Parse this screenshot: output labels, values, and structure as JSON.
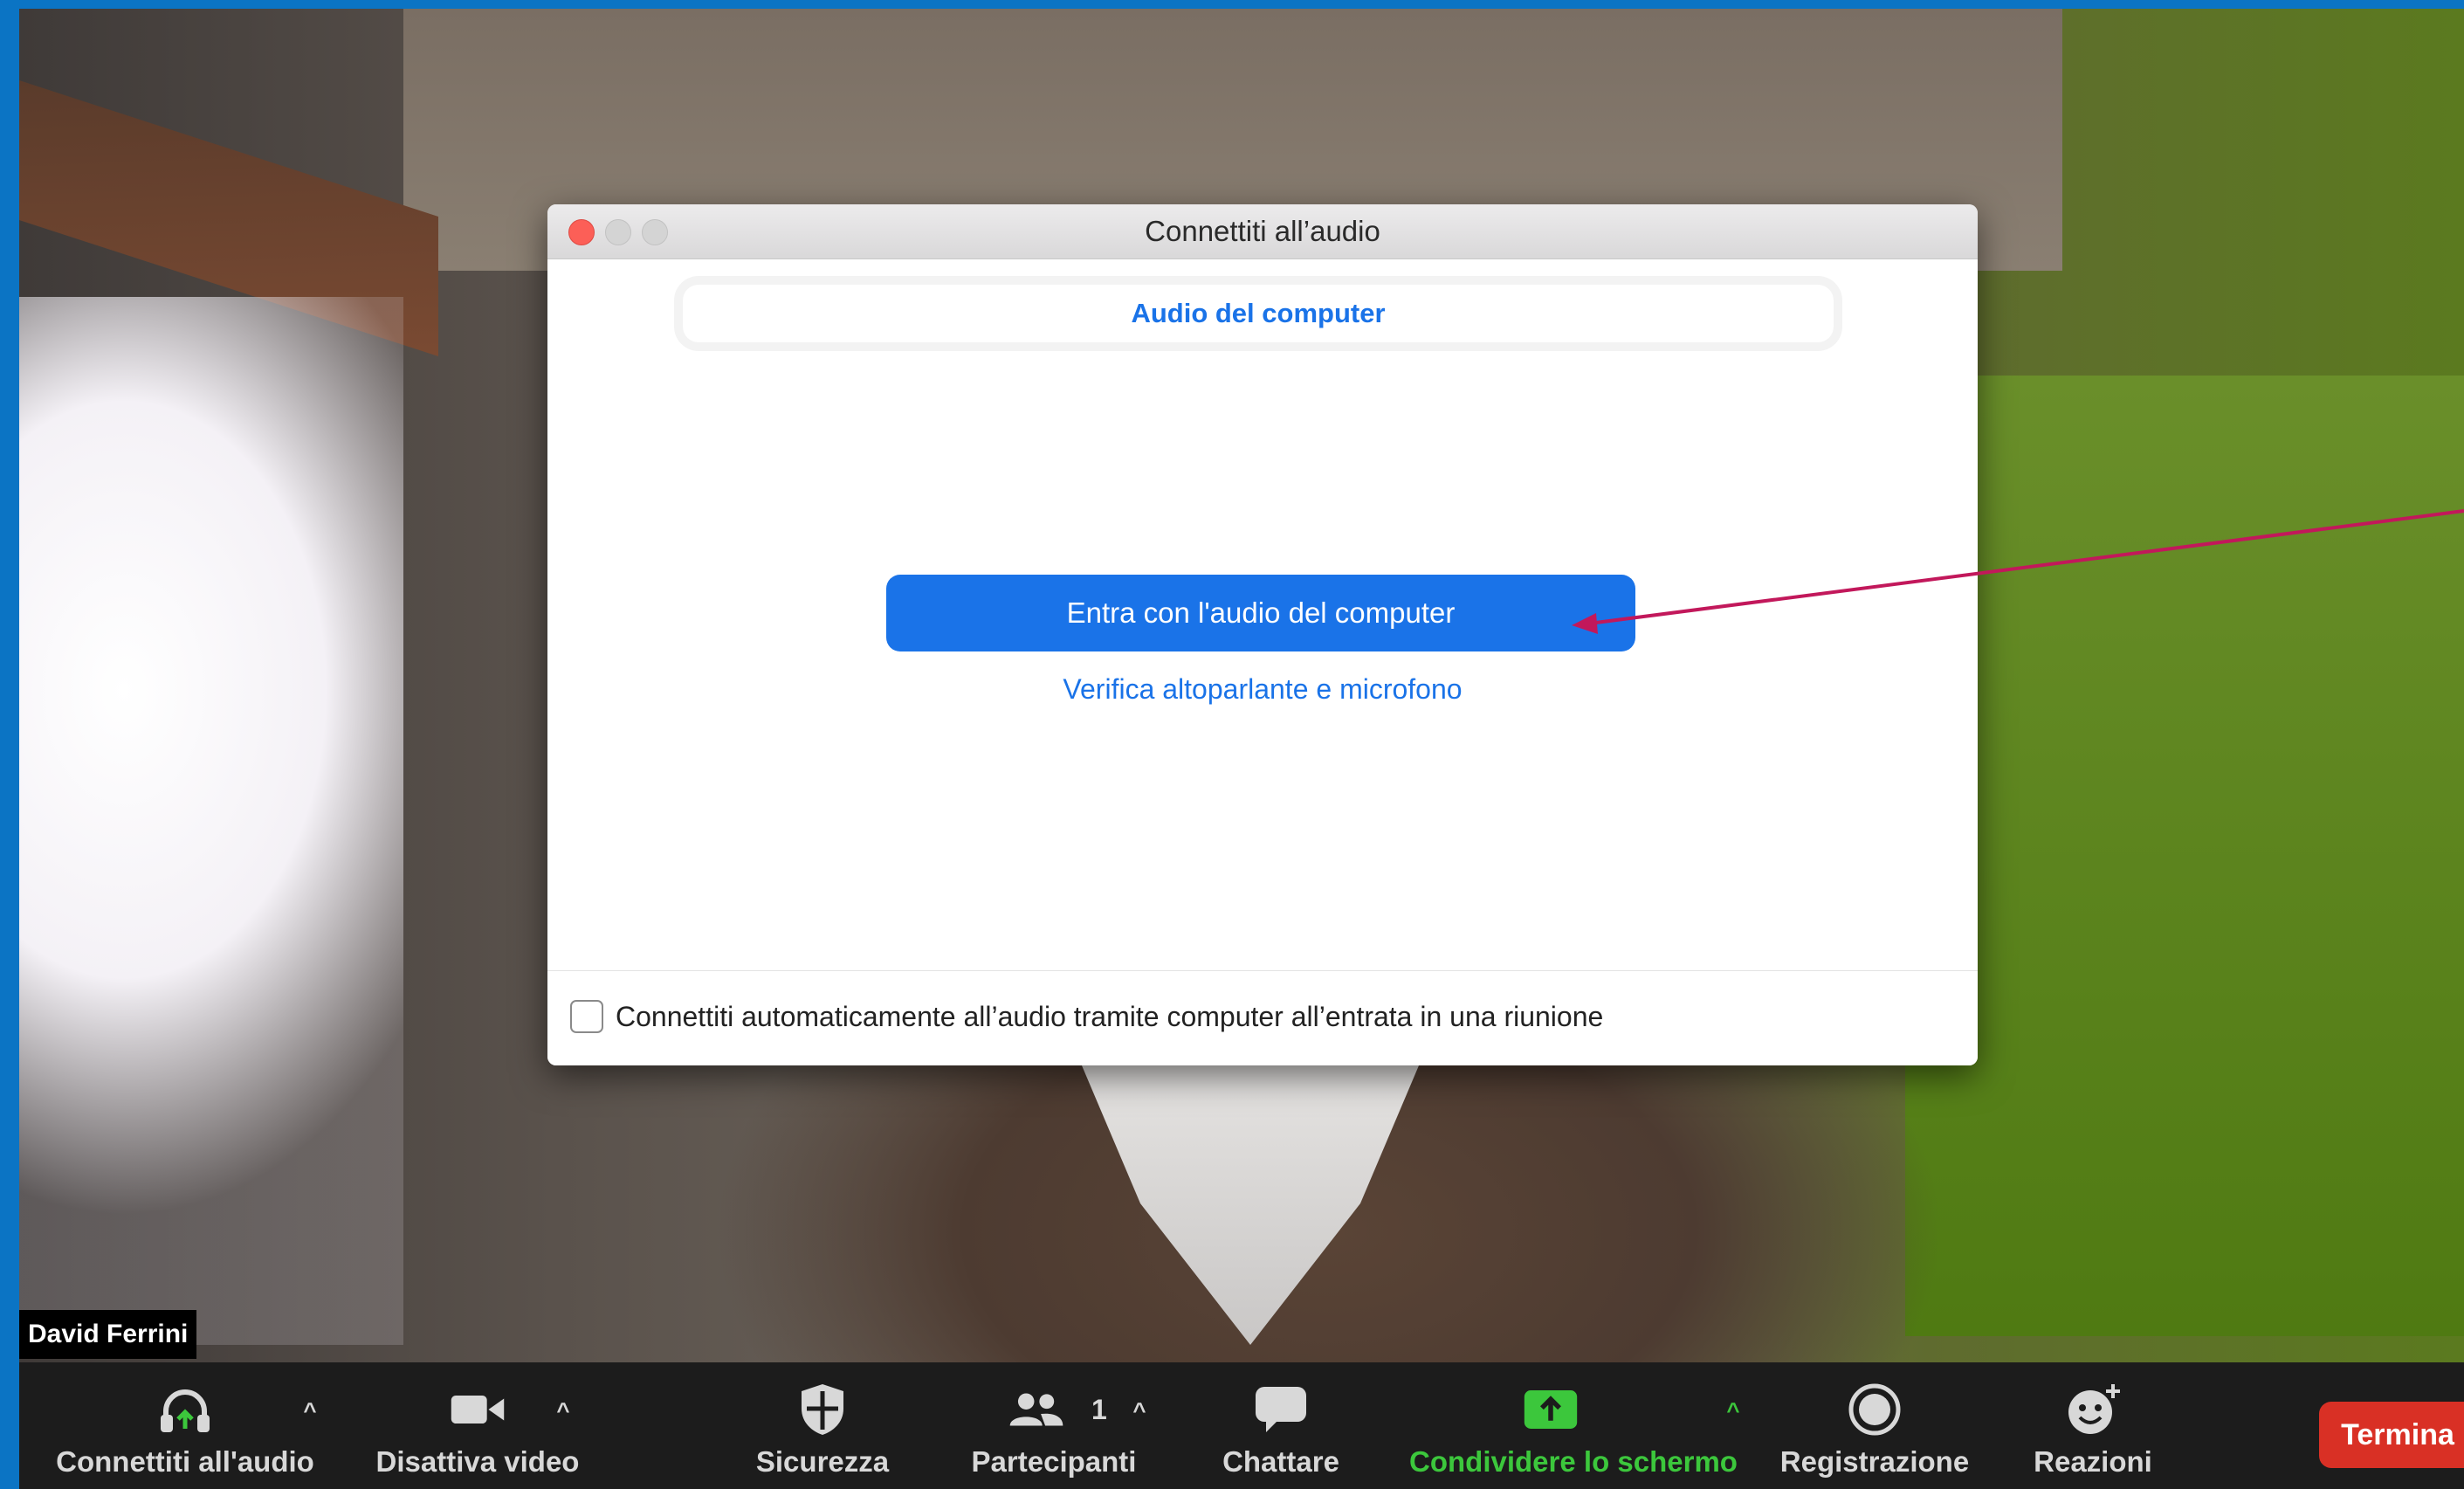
{
  "dialog": {
    "title": "Connettiti all’audio",
    "tab_label": "Audio del computer",
    "join_button_label": "Entra con l'audio del computer",
    "test_link_label": "Verifica altoparlante e microfono",
    "auto_connect_label": "Connettiti automaticamente all’audio tramite computer all’entrata in una riunione",
    "auto_connect_checked": false
  },
  "participant": {
    "name": "David Ferrini"
  },
  "toolbar": {
    "audio_label": "Connettiti all'audio",
    "video_label": "Disattiva video",
    "security_label": "Sicurezza",
    "participants_label": "Partecipanti",
    "participants_count": "1",
    "chat_label": "Chattare",
    "share_label": "Condividere lo schermo",
    "record_label": "Registrazione",
    "reactions_label": "Reazioni",
    "end_label": "Termina"
  },
  "colors": {
    "accent_blue": "#1a73e8",
    "share_green": "#3cc73c",
    "end_red": "#d93025",
    "page_border": "#0b74c4"
  },
  "icons": {
    "audio": "headphones-icon",
    "video": "video-camera-icon",
    "security": "shield-icon",
    "participants": "people-icon",
    "chat": "chat-bubble-icon",
    "share": "share-screen-icon",
    "record": "record-icon",
    "reactions": "emoji-icon"
  }
}
